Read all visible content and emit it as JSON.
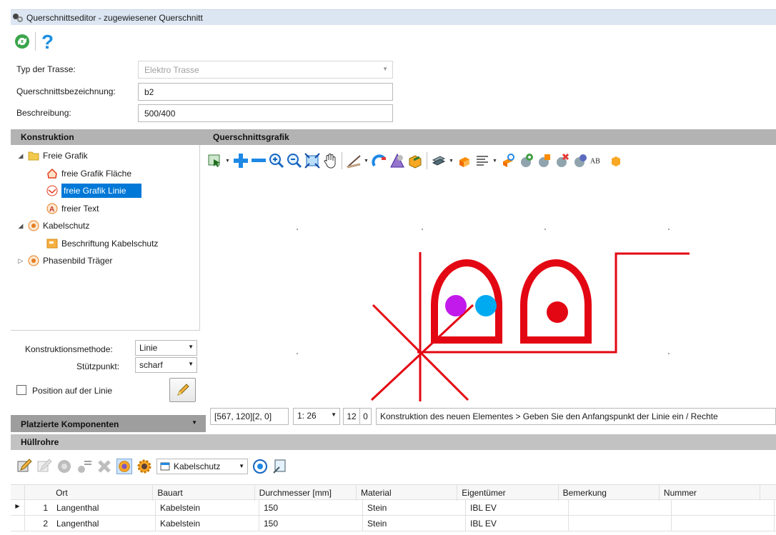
{
  "window": {
    "title": "Querschnittseditor - zugewiesener Querschnitt"
  },
  "form": {
    "typ_label": "Typ der Trasse:",
    "typ_value": "Elektro Trasse",
    "bez_label": "Querschnittsbezeichnung:",
    "bez_value": "b2",
    "beschr_label": "Beschreibung:",
    "beschr_value": "500/400"
  },
  "konstruktion": {
    "header": "Konstruktion",
    "tree": [
      {
        "label": "Freie Grafik"
      },
      {
        "label": "freie Grafik Fläche"
      },
      {
        "label": "freie Grafik Linie"
      },
      {
        "label": "freier Text"
      },
      {
        "label": "Kabelschutz"
      },
      {
        "label": "Beschriftung Kabelschutz"
      },
      {
        "label": "Phasenbild Träger"
      }
    ],
    "methode_label": "Konstruktionsmethode:",
    "methode_value": "Linie",
    "stuetz_label": "Stützpunkt:",
    "stuetz_value": "scharf",
    "position_label": "Position auf der Linie"
  },
  "grafik": {
    "header": "Querschnittsgrafik",
    "text_icon_label": "AB"
  },
  "statusbar": {
    "coords": "[567, 120][2, 0]",
    "scale": "1: 26",
    "grid": "12",
    "grid2": "0",
    "message": "Konstruktion des neuen Elementes > Geben Sie den Anfangspunkt der Linie ein / Rechte"
  },
  "platzierte": {
    "header": "Platzierte Komponenten"
  },
  "huellrohre": {
    "header": "Hüllrohre",
    "filter_value": "Kabelschutz",
    "columns": [
      "Ort",
      "Bauart",
      "Durchmesser [mm]",
      "Material",
      "Eigentümer",
      "Bemerkung",
      "Nummer"
    ],
    "rows": [
      {
        "num": "1",
        "cells": [
          "Langenthal",
          "Kabelstein",
          "150",
          "Stein",
          "IBL EV",
          "",
          ""
        ]
      },
      {
        "num": "2",
        "cells": [
          "Langenthal",
          "Kabelstein",
          "150",
          "Stein",
          "IBL EV",
          "",
          ""
        ]
      }
    ]
  },
  "colors": {
    "accent": "#0078d7",
    "drawing_red": "#e30613",
    "circle_purple": "#c21aea",
    "circle_blue": "#00aaf0"
  }
}
